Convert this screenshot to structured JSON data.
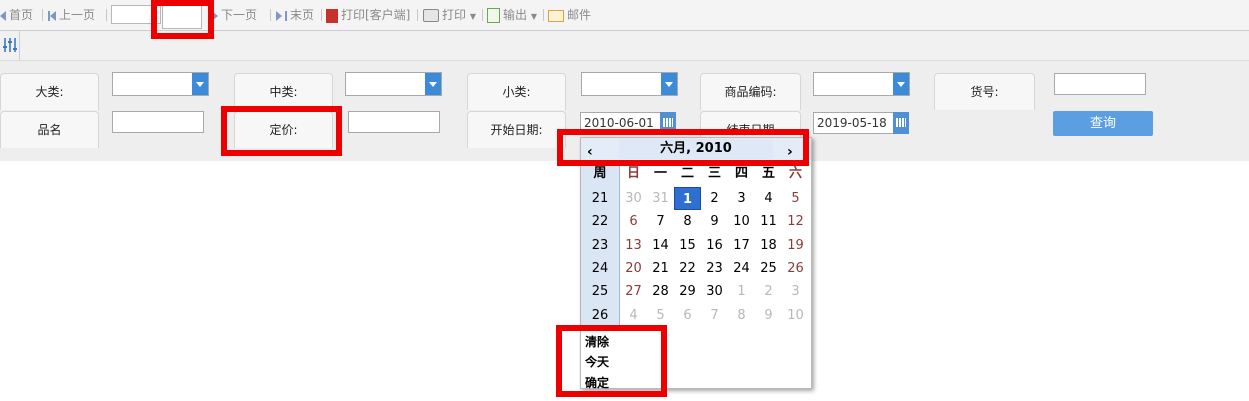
{
  "toolbar": {
    "first": "首页",
    "prev": "上一页",
    "next": "下一页",
    "last": "末页",
    "print_client": "打印[客户端]",
    "print": "打印",
    "export": "输出",
    "mail": "邮件"
  },
  "filters": {
    "category": "大类:",
    "mid_category": "中类:",
    "sub_category": "小类:",
    "product_code": "商品编码:",
    "item_no": "货号:",
    "name": "品名",
    "price": "定价:",
    "start_date": "开始日期:",
    "end_date": "结束日期",
    "start_date_value": "2010-06-01",
    "end_date_value": "2019-05-18"
  },
  "query_button": "查询",
  "calendar": {
    "month_title": "六月, 2010",
    "prev": "‹",
    "next": "›",
    "week_header": "周",
    "day_headers": [
      "日",
      "一",
      "二",
      "三",
      "四",
      "五",
      "六"
    ],
    "weeks": [
      "21",
      "22",
      "23",
      "24",
      "25",
      "26"
    ],
    "days": [
      [
        "30",
        "31",
        "1",
        "2",
        "3",
        "4",
        "5"
      ],
      [
        "6",
        "7",
        "8",
        "9",
        "10",
        "11",
        "12"
      ],
      [
        "13",
        "14",
        "15",
        "16",
        "17",
        "18",
        "19"
      ],
      [
        "20",
        "21",
        "22",
        "23",
        "24",
        "25",
        "26"
      ],
      [
        "27",
        "28",
        "29",
        "30",
        "1",
        "2",
        "3"
      ],
      [
        "4",
        "5",
        "6",
        "7",
        "8",
        "9",
        "10"
      ]
    ],
    "selected_day": "1",
    "clear": "清除",
    "today": "今天",
    "confirm": "确定"
  },
  "colors": {
    "accent": "#5b9ee2",
    "highlight_box": "#ee0000",
    "selected_day": "#2e6fd1"
  }
}
